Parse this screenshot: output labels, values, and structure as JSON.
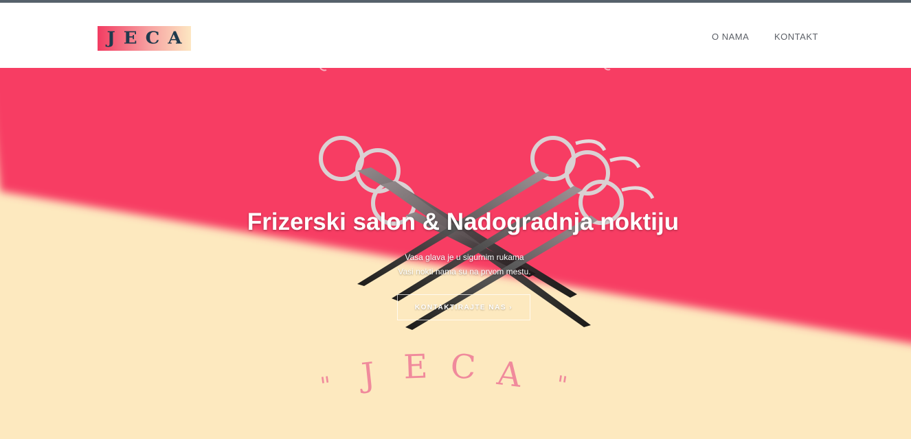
{
  "header": {
    "logo_text": "JECA",
    "nav": [
      {
        "label": "O NAMA"
      },
      {
        "label": "KONTAKT"
      }
    ]
  },
  "hero": {
    "title": "Frizerski salon & Nadogradnja noktiju",
    "subtitle_line1": "Vasa glava je u sigurnim rukama",
    "subtitle_line2": "Vasi nokti nama su na prvom mestu.",
    "cta_label": "KONTAKTIRAJTE NAS ›",
    "background_text": "\" J E C A \""
  },
  "colors": {
    "accent_pink": "#f73d63",
    "cream": "#fde9bf",
    "logo_text": "#1f3a4d"
  }
}
